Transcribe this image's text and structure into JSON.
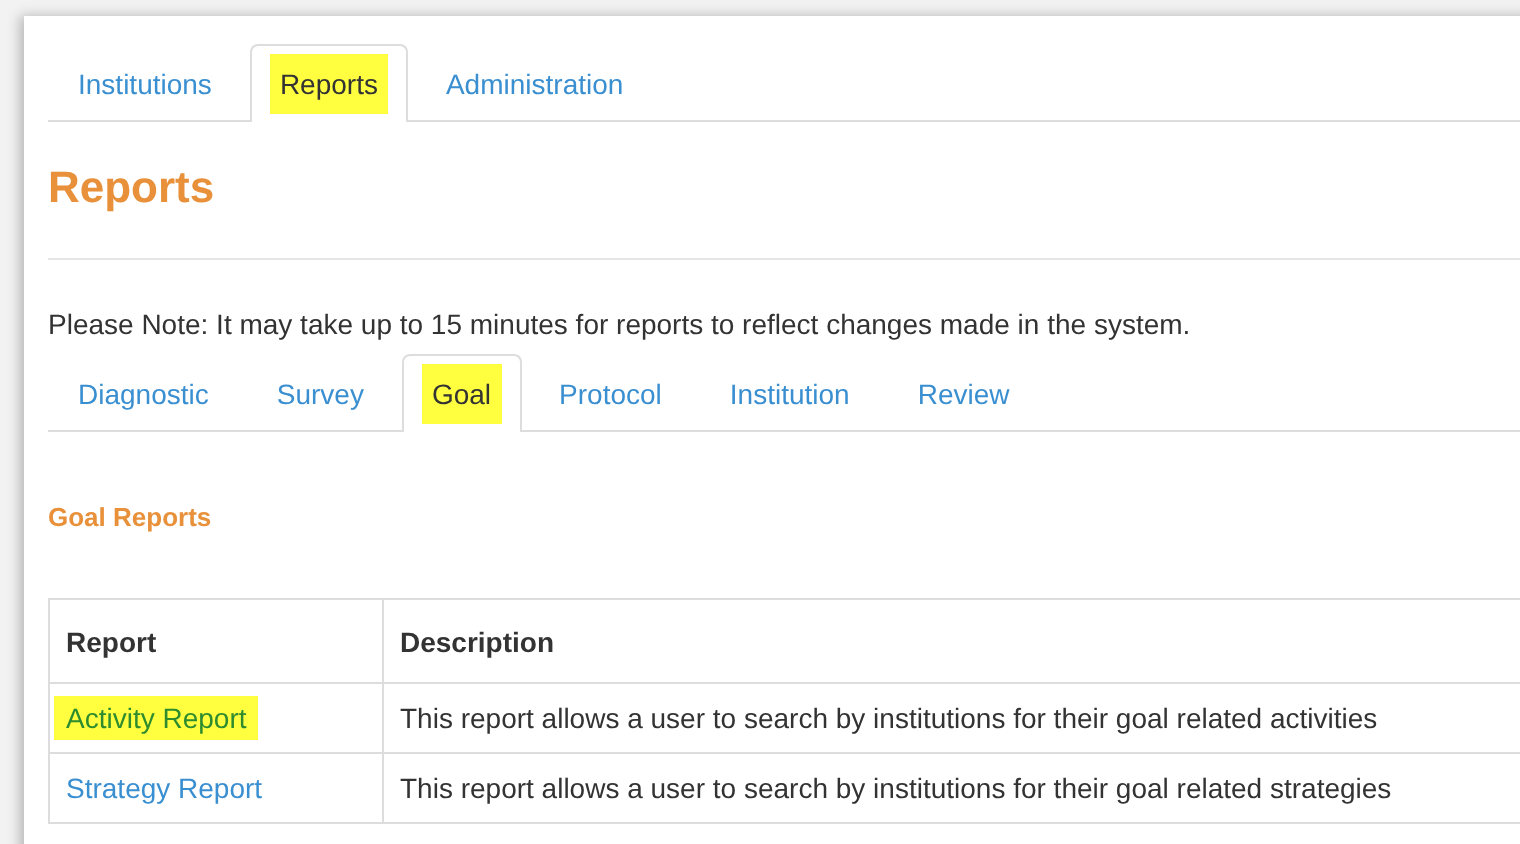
{
  "main_tabs": [
    {
      "label": "Institutions",
      "selected": false,
      "highlighted": false
    },
    {
      "label": "Reports",
      "selected": true,
      "highlighted": true
    },
    {
      "label": "Administration",
      "selected": false,
      "highlighted": false
    }
  ],
  "page_title": "Reports",
  "note": "Please Note: It may take up to 15 minutes for reports to reflect changes made in the system.",
  "report_tabs": [
    {
      "label": "Diagnostic",
      "selected": false,
      "highlighted": false
    },
    {
      "label": "Survey",
      "selected": false,
      "highlighted": false
    },
    {
      "label": "Goal",
      "selected": true,
      "highlighted": true
    },
    {
      "label": "Protocol",
      "selected": false,
      "highlighted": false
    },
    {
      "label": "Institution",
      "selected": false,
      "highlighted": false
    },
    {
      "label": "Review",
      "selected": false,
      "highlighted": false
    }
  ],
  "section_title": "Goal Reports",
  "table": {
    "columns": [
      "Report",
      "Description"
    ],
    "rows": [
      {
        "report": "Activity Report",
        "description": "This report allows a user to search by institutions for their goal related activities",
        "highlighted": true
      },
      {
        "report": "Strategy Report",
        "description": "This report allows a user to search by institutions for their goal related strategies",
        "highlighted": false
      }
    ]
  }
}
